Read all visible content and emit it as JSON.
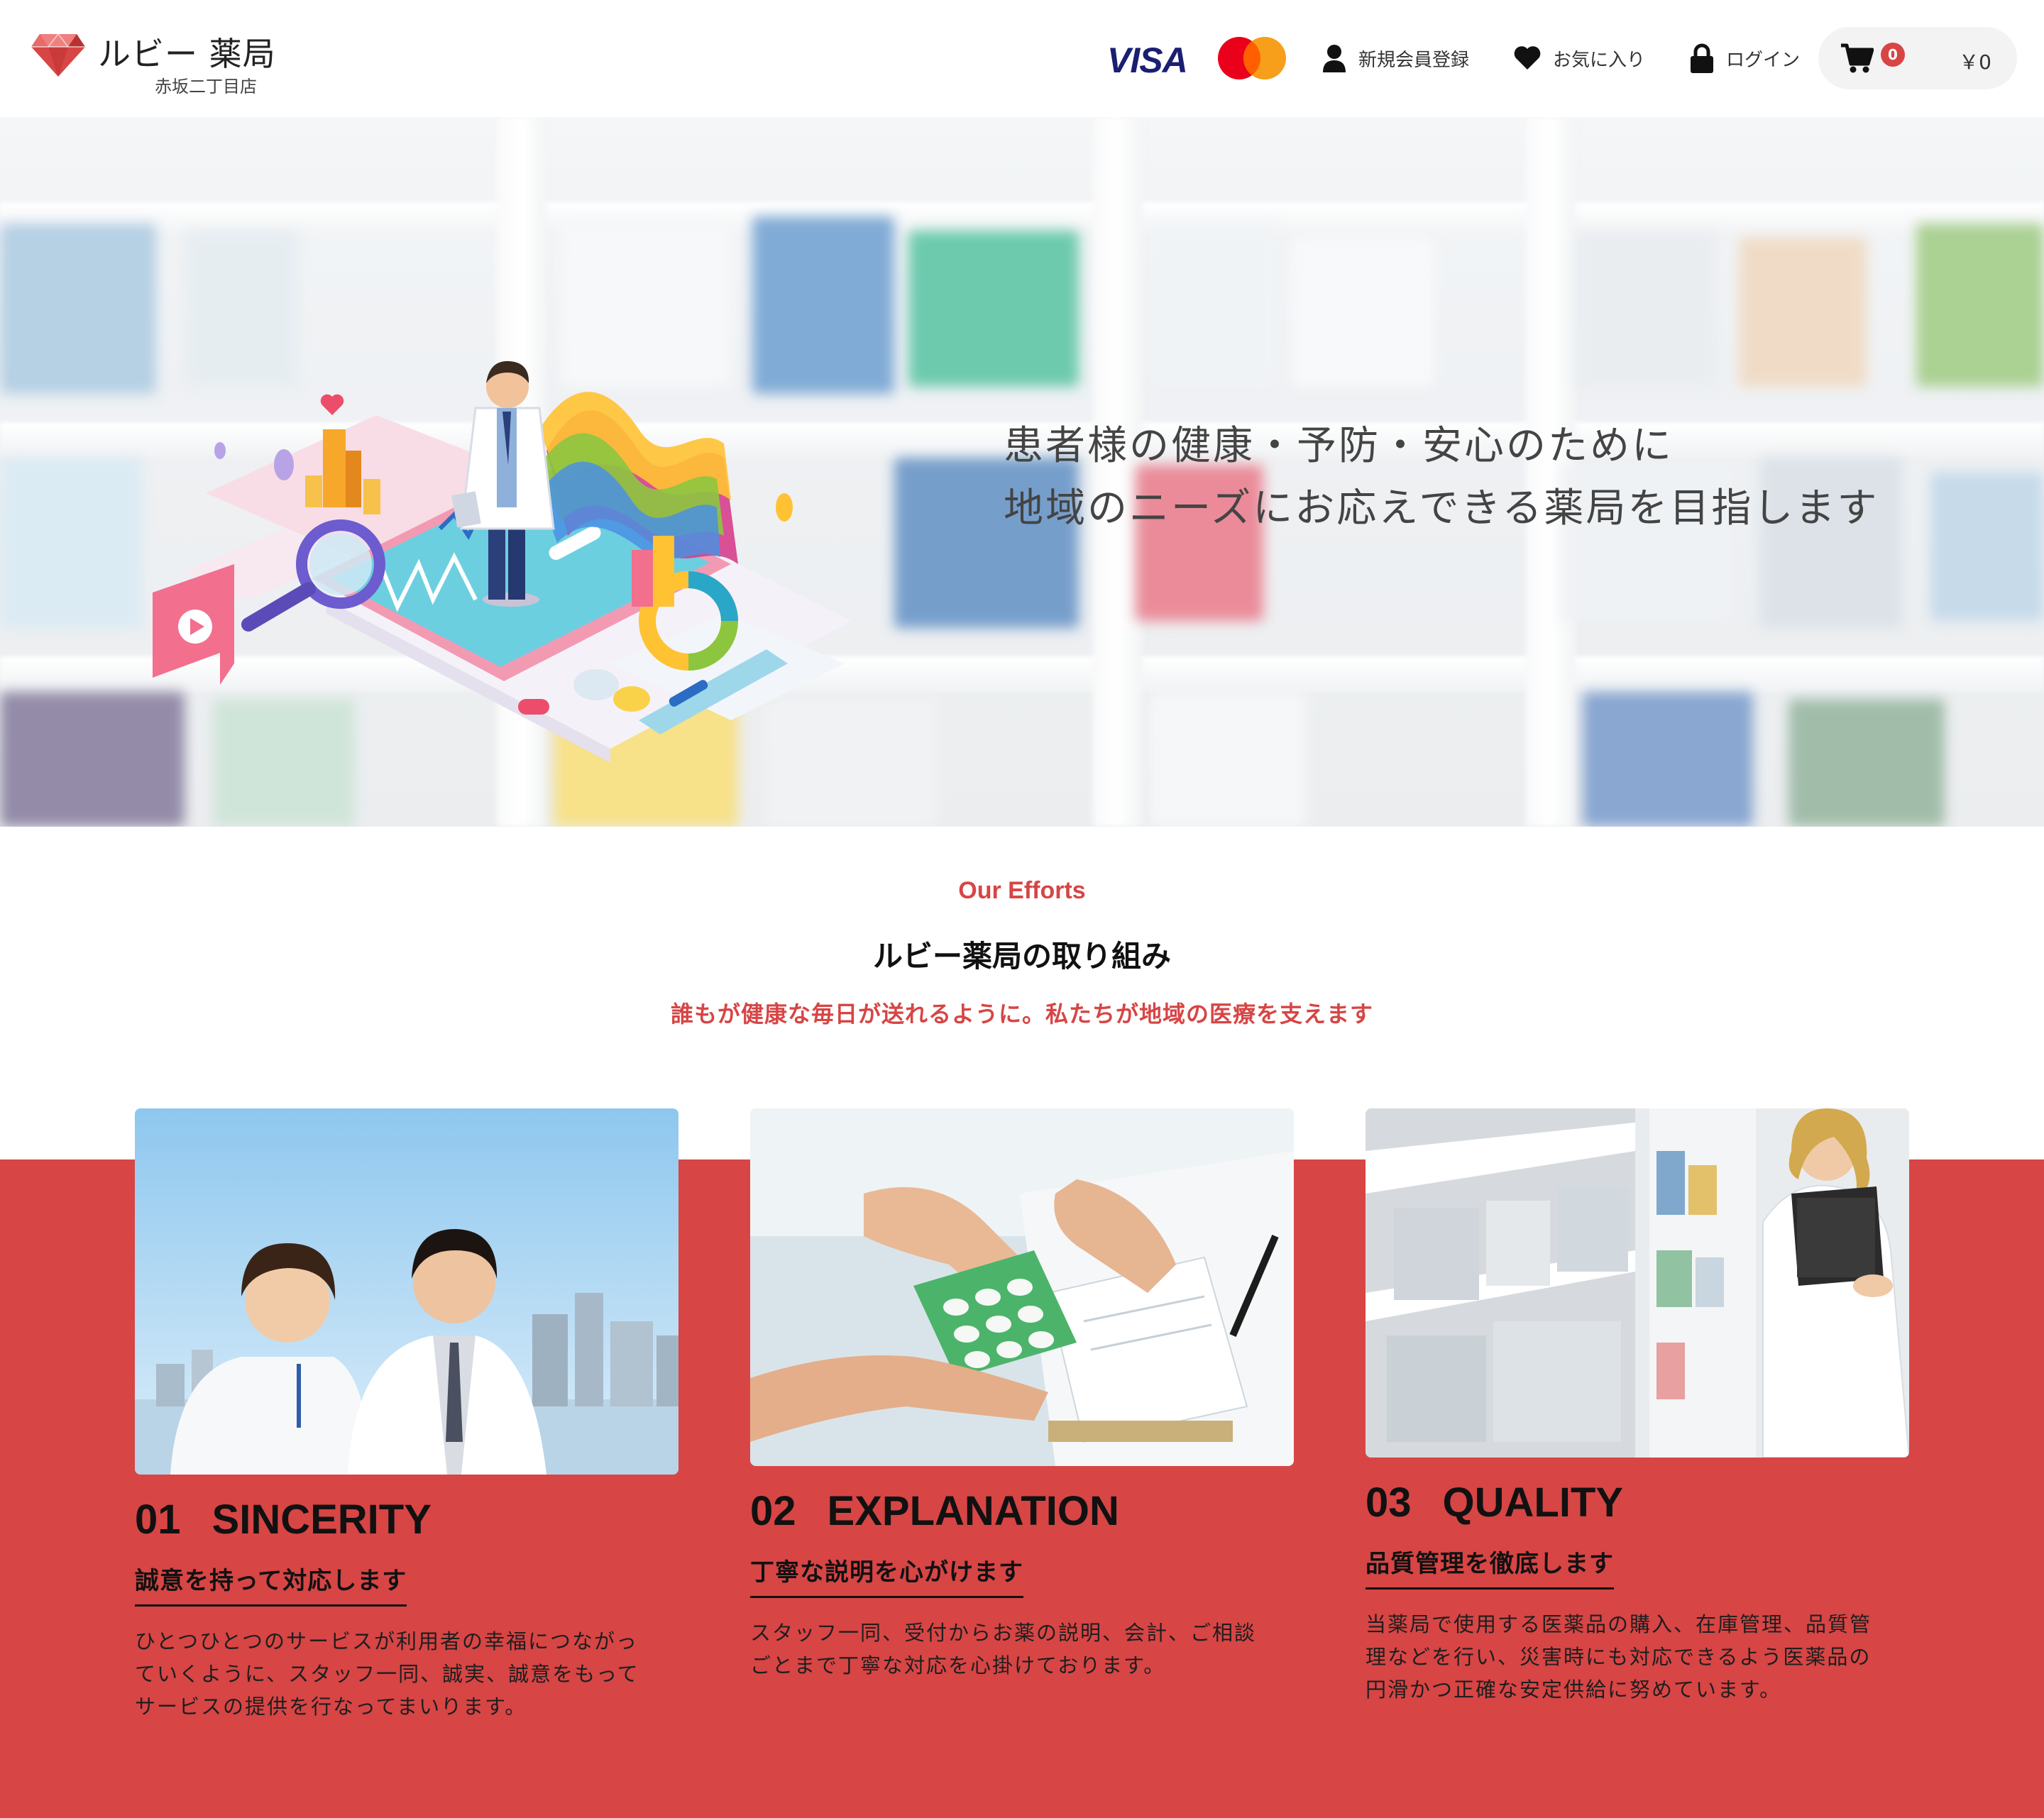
{
  "brand": {
    "name": "ルビー 薬局",
    "branch": "赤坂二丁目店",
    "gem_color": "#d74545"
  },
  "header": {
    "payments": {
      "visa": "VISA",
      "mastercard_colors": [
        "#eb001b",
        "#f79e1b"
      ]
    },
    "nav": {
      "register": "新規会員登録",
      "favorites": "お気に入り",
      "login": "ログイン"
    },
    "cart": {
      "count": "0",
      "total": "￥0"
    }
  },
  "hero": {
    "lines": [
      "患者様の健康・予防・安心のために",
      "地域のニーズにお応えできる薬局を目指します"
    ]
  },
  "efforts": {
    "eyebrow": "Our Efforts",
    "title": "ルビー薬局の取り組み",
    "subtitle": "誰もが健康な毎日が送れるように。私たちが地域の医療を支えます",
    "accent": "#d74545",
    "cards": [
      {
        "num": "01",
        "title": "SINCERITY",
        "subtitle": "誠意を持って対応します",
        "body": [
          "ひとつひとつのサービスが利用者の幸福につながっ",
          "ていくように、スタッフ一同、誠実、誠意をもって",
          "サービスの提供を行なってまいります。"
        ]
      },
      {
        "num": "02",
        "title": "EXPLANATION",
        "subtitle": "丁寧な説明を心がけます",
        "body": [
          "スタッフ一同、受付からお薬の説明、会計、ご相談",
          "ごとまで丁寧な対応を心掛けております。"
        ]
      },
      {
        "num": "03",
        "title": "QUALITY",
        "subtitle": "品質管理を徹底します",
        "body": [
          "当薬局で使用する医薬品の購入、在庫管理、品質管",
          "理などを行い、災害時にも対応できるよう医薬品の",
          "円滑かつ正確な安定供給に努めています。"
        ]
      }
    ]
  }
}
